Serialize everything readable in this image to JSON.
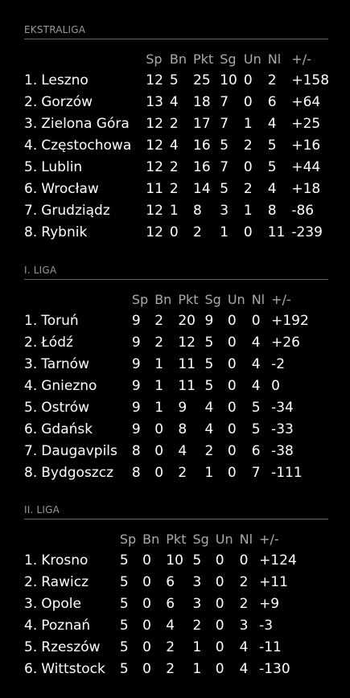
{
  "colors": {
    "background": "#000000",
    "text": "#ffffff",
    "header_text": "#aaaaaa",
    "section_title": "#999999",
    "divider": "#666666"
  },
  "leagues": [
    {
      "title": "EKSTRALIGA",
      "columns": [
        "Sp",
        "Bn",
        "Pkt",
        "Sg",
        "Un",
        "Nl",
        "+/-"
      ],
      "rows": [
        {
          "rank": "1.",
          "team": "Leszno",
          "sp": "12",
          "bn": "5",
          "pkt": "25",
          "sg": "10",
          "un": "0",
          "nl": "2",
          "diff": "+158"
        },
        {
          "rank": "2.",
          "team": "Gorzów",
          "sp": "13",
          "bn": "4",
          "pkt": "18",
          "sg": "7",
          "un": "0",
          "nl": "6",
          "diff": "+64"
        },
        {
          "rank": "3.",
          "team": "Zielona Góra",
          "sp": "12",
          "bn": "2",
          "pkt": "17",
          "sg": "7",
          "un": "1",
          "nl": "4",
          "diff": "+25"
        },
        {
          "rank": "4.",
          "team": "Częstochowa",
          "sp": "12",
          "bn": "4",
          "pkt": "16",
          "sg": "5",
          "un": "2",
          "nl": "5",
          "diff": "+16"
        },
        {
          "rank": "5.",
          "team": "Lublin",
          "sp": "12",
          "bn": "2",
          "pkt": "16",
          "sg": "7",
          "un": "0",
          "nl": "5",
          "diff": "+44"
        },
        {
          "rank": "6.",
          "team": "Wrocław",
          "sp": "11",
          "bn": "2",
          "pkt": "14",
          "sg": "5",
          "un": "2",
          "nl": "4",
          "diff": "+18"
        },
        {
          "rank": "7.",
          "team": "Grudziądz",
          "sp": "12",
          "bn": "1",
          "pkt": "8",
          "sg": "3",
          "un": "1",
          "nl": "8",
          "diff": "-86"
        },
        {
          "rank": "8.",
          "team": "Rybnik",
          "sp": "12",
          "bn": "0",
          "pkt": "2",
          "sg": "1",
          "un": "0",
          "nl": "11",
          "diff": "-239"
        }
      ]
    },
    {
      "title": "I. LIGA",
      "columns": [
        "Sp",
        "Bn",
        "Pkt",
        "Sg",
        "Un",
        "Nl",
        "+/-"
      ],
      "rows": [
        {
          "rank": "1.",
          "team": "Toruń",
          "sp": "9",
          "bn": "2",
          "pkt": "20",
          "sg": "9",
          "un": "0",
          "nl": "0",
          "diff": "+192"
        },
        {
          "rank": "2.",
          "team": "Łódź",
          "sp": "9",
          "bn": "2",
          "pkt": "12",
          "sg": "5",
          "un": "0",
          "nl": "4",
          "diff": "+26"
        },
        {
          "rank": "3.",
          "team": "Tarnów",
          "sp": "9",
          "bn": "1",
          "pkt": "11",
          "sg": "5",
          "un": "0",
          "nl": "4",
          "diff": "-2"
        },
        {
          "rank": "4.",
          "team": "Gniezno",
          "sp": "9",
          "bn": "1",
          "pkt": "11",
          "sg": "5",
          "un": "0",
          "nl": "4",
          "diff": "0"
        },
        {
          "rank": "5.",
          "team": "Ostrów",
          "sp": "9",
          "bn": "1",
          "pkt": "9",
          "sg": "4",
          "un": "0",
          "nl": "5",
          "diff": "-34"
        },
        {
          "rank": "6.",
          "team": "Gdańsk",
          "sp": "9",
          "bn": "0",
          "pkt": "8",
          "sg": "4",
          "un": "0",
          "nl": "5",
          "diff": "-33"
        },
        {
          "rank": "7.",
          "team": "Daugavpils",
          "sp": "8",
          "bn": "0",
          "pkt": "4",
          "sg": "2",
          "un": "0",
          "nl": "6",
          "diff": "-38"
        },
        {
          "rank": "8.",
          "team": "Bydgoszcz",
          "sp": "8",
          "bn": "0",
          "pkt": "2",
          "sg": "1",
          "un": "0",
          "nl": "7",
          "diff": "-111"
        }
      ]
    },
    {
      "title": "II. LIGA",
      "columns": [
        "Sp",
        "Bn",
        "Pkt",
        "Sg",
        "Un",
        "Nl",
        "+/-"
      ],
      "rows": [
        {
          "rank": "1.",
          "team": "Krosno",
          "sp": "5",
          "bn": "0",
          "pkt": "10",
          "sg": "5",
          "un": "0",
          "nl": "0",
          "diff": "+124"
        },
        {
          "rank": "2.",
          "team": "Rawicz",
          "sp": "5",
          "bn": "0",
          "pkt": "6",
          "sg": "3",
          "un": "0",
          "nl": "2",
          "diff": "+11"
        },
        {
          "rank": "3.",
          "team": "Opole",
          "sp": "5",
          "bn": "0",
          "pkt": "6",
          "sg": "3",
          "un": "0",
          "nl": "2",
          "diff": "+9"
        },
        {
          "rank": "4.",
          "team": "Poznań",
          "sp": "5",
          "bn": "0",
          "pkt": "4",
          "sg": "2",
          "un": "0",
          "nl": "3",
          "diff": "-3"
        },
        {
          "rank": "5.",
          "team": "Rzeszów",
          "sp": "5",
          "bn": "0",
          "pkt": "2",
          "sg": "1",
          "un": "0",
          "nl": "4",
          "diff": "-11"
        },
        {
          "rank": "6.",
          "team": "Wittstock",
          "sp": "5",
          "bn": "0",
          "pkt": "2",
          "sg": "1",
          "un": "0",
          "nl": "4",
          "diff": "-130"
        }
      ]
    }
  ]
}
